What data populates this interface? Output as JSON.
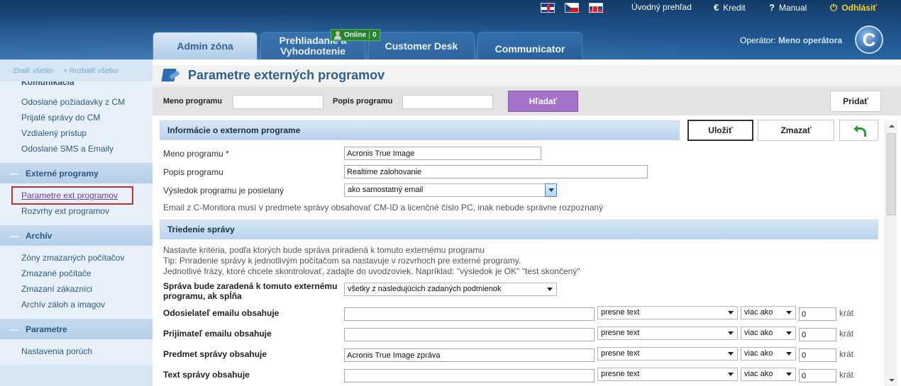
{
  "header": {
    "links": {
      "home": "Úvodný prehľad",
      "credit": "Kredit",
      "credit_icon": "€",
      "manual": "Manual",
      "manual_icon": "?",
      "logout": "Odhlásiť",
      "logout_icon": "⏻"
    },
    "tabs": {
      "admin": "Admin zóna",
      "review_line1": "Prehliadanie a",
      "review_line2": "Vyhodnotenie",
      "customer_desk": "Customer Desk",
      "communicator": "Communicator"
    },
    "online_badge": {
      "label": "Online",
      "count": "0"
    },
    "operator_label": "Operátor:",
    "operator_name": "Meno operátora",
    "logo_letter": "C"
  },
  "sidebar": {
    "collapse_all": "- Zbaliť všetko",
    "expand_all": "+ Rozbaliť všetko",
    "cut_title": "Komunikácia",
    "comm_items": [
      "Odoslané požiadavky z CM",
      "Prijaté správy do CM",
      "Vzdialený prístup",
      "Odoslané SMS a Emaily"
    ],
    "external_section": "Externé programy",
    "external_items": [
      "Parametre ext programov",
      "Rozvrhy ext programov"
    ],
    "archive_section": "Archív",
    "archive_items": [
      "Zóny zmazaných počítačov",
      "Zmazané počítače",
      "Zmazaní zákazníci",
      "Archív záloh a imagov"
    ],
    "params_section": "Parametre",
    "params_items": [
      "Nastavenia porúch"
    ]
  },
  "page": {
    "title": "Parametre externých programov",
    "search": {
      "name_label": "Meno programu",
      "desc_label": "Popis programu",
      "search_button": "Hľadať",
      "add_button": "Pridať"
    },
    "actions": {
      "save": "Uložiť",
      "delete": "Zmazať"
    },
    "info_section": {
      "title": "Informácie o externom programe",
      "name_label": "Meno programu *",
      "name_value": "Acronis True Image",
      "desc_label": "Popis programu",
      "desc_value": "Realtime zalohovanie",
      "result_label": "Výsledok programu je posielaný",
      "result_value": "ako samostatný email",
      "note": "Email z C-Monitora musí v predmete správy obsahovať CM-ID a licenčné číslo PC, inak nebude správne rozpoznaný"
    },
    "sort_section": {
      "title": "Triedenie správy",
      "tip1": "Nastavte kritéria, podľa ktorých bude správa priradená k tomuto externému programu",
      "tip2": "Tip: Priradenie správy k jednotlivým počítačom sa nastavuje v rozvrhoch pre externé programy.",
      "tip3": "Jednotlivé frázy, ktoré chcete skontrolovať, zadajte do uvodzoviek. Napríklad: \"výsledok je OK\" \"test skončený\"",
      "assign_label_1": "Správa bude zaradená k tomuto externému",
      "assign_label_2": "programu, ak spĺňa",
      "assign_value": "všetky z nasledujúcich zadaných podmienok",
      "rows": [
        {
          "label": "Odosielateľ emailu obsahuje",
          "value": "",
          "match": "presne text",
          "cmp": "viac ako",
          "count": "0",
          "unit": "krát"
        },
        {
          "label": "Prijímateľ emailu obsahuje",
          "value": "",
          "match": "presne text",
          "cmp": "viac ako",
          "count": "0",
          "unit": "krát"
        },
        {
          "label": "Predmet správy obsahuje",
          "value": "Acronis True Image zpráva",
          "match": "presne text",
          "cmp": "viac ako",
          "count": "0",
          "unit": "krát"
        },
        {
          "label": "Text správy obsahuje",
          "value": "",
          "match": "presne text",
          "cmp": "viac ako",
          "count": "0",
          "unit": "krát"
        }
      ]
    }
  }
}
